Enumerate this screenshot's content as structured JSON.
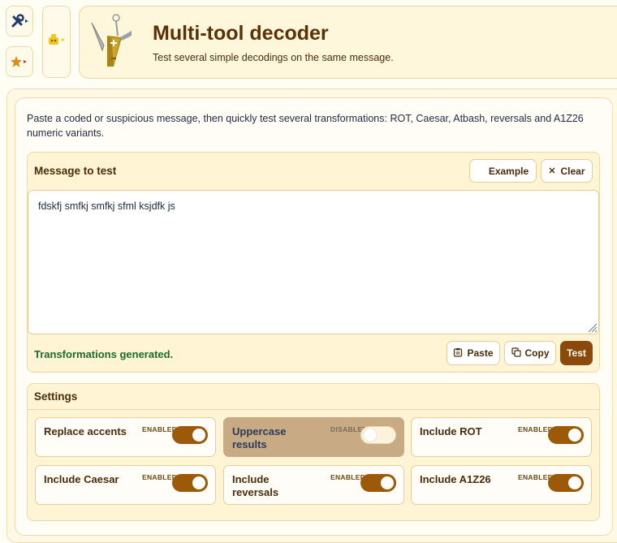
{
  "side": {
    "tools_icon": "tools-icon",
    "favorite_icon": "star-icon",
    "robot_icon": "robot-icon"
  },
  "header": {
    "title": "Multi-tool decoder",
    "subtitle": "Test several simple decodings on the same message.",
    "icon": "multitool-icon"
  },
  "intro": "Paste a coded or suspicious message, then quickly test several transformations: ROT, Caesar, Atbash, reversals and A1Z26 numeric variants.",
  "message": {
    "title": "Message to test",
    "example_label": "Example",
    "clear_label": "Clear",
    "value": "fdskfj smfkj smfkj sfml ksjdfk js",
    "status": "Transformations generated.",
    "paste_label": "Paste",
    "copy_label": "Copy",
    "test_label": "Test"
  },
  "settings": {
    "title": "Settings",
    "options": [
      {
        "label": "Replace accents",
        "state": "ENABLED",
        "on": true
      },
      {
        "label": "Uppercase results",
        "state": "DISABLED",
        "on": false
      },
      {
        "label": "Include ROT",
        "state": "ENABLED",
        "on": true
      },
      {
        "label": "Include Caesar",
        "state": "ENABLED",
        "on": true
      },
      {
        "label": "Include reversals",
        "state": "ENABLED",
        "on": true
      },
      {
        "label": "Include A1Z26",
        "state": "ENABLED",
        "on": true
      }
    ]
  },
  "colors": {
    "accent": "#8b4a0a",
    "toggle_on": "#9c5a08",
    "success": "#1a6b2e",
    "panel": "#fff5d4"
  }
}
